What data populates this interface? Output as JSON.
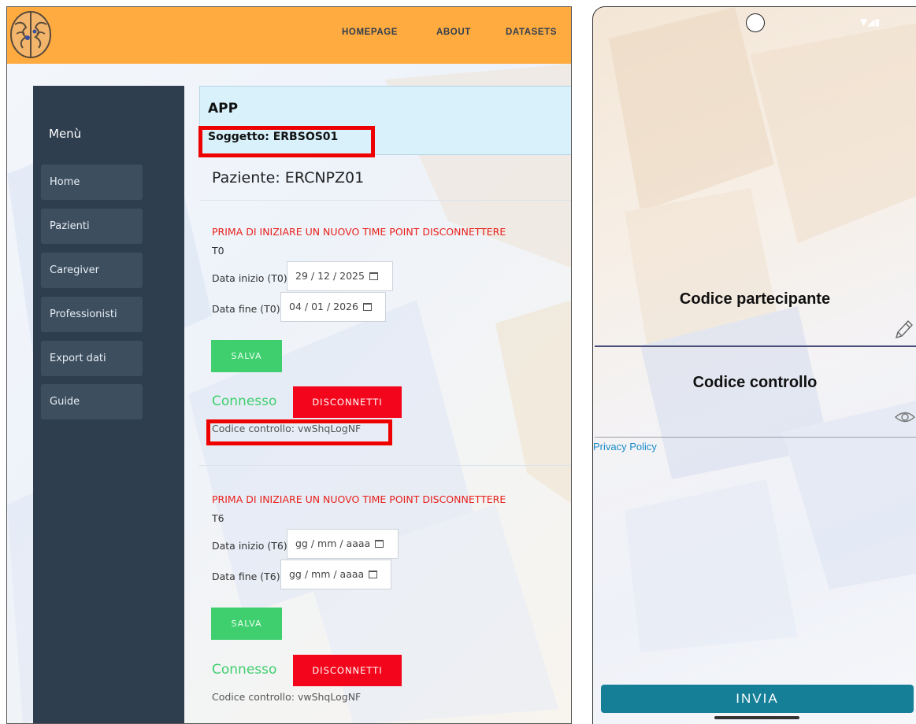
{
  "web": {
    "nav": {
      "homepage": "HOMEPAGE",
      "about": "ABOUT",
      "datasets": "DATASETS"
    },
    "sidebar": {
      "title": "Menù",
      "items": [
        {
          "label": "Home"
        },
        {
          "label": "Pazienti"
        },
        {
          "label": "Caregiver"
        },
        {
          "label": "Professionisti"
        },
        {
          "label": "Export dati"
        },
        {
          "label": "Guide"
        }
      ]
    },
    "app_card": {
      "title": "APP",
      "subject": "Soggetto: ERBSOS01"
    },
    "patient": "Paziente: ERCNPZ01",
    "timepoints": [
      {
        "warning": "PRIMA DI INIZIARE UN NUOVO TIME POINT DISCONNETTERE",
        "label": "T0",
        "start_label": "Data inizio (T0)",
        "start_value": "29 / 12 / 2025",
        "end_label": "Data fine (T0)",
        "end_value": "04 / 01 / 2026",
        "save_label": "SALVA",
        "status": "Connesso",
        "disconnect_label": "DISCONNETTI",
        "code": "Codice controllo: vwShqLogNF"
      },
      {
        "warning": "PRIMA DI INIZIARE UN NUOVO TIME POINT DISCONNETTERE",
        "label": "T6",
        "start_label": "Data inizio (T6)",
        "start_value": "gg / mm / aaaa",
        "end_label": "Data fine (T6)",
        "end_value": "gg / mm / aaaa",
        "save_label": "SALVA",
        "status": "Connesso",
        "disconnect_label": "DISCONNETTI",
        "code": "Codice controllo: vwShqLogNF"
      }
    ],
    "colors": {
      "header": "#ffab40",
      "sidebar": "#2f3e4e",
      "save": "#3fcf6e",
      "disconnect": "#f3061b",
      "highlight": "#ee0000"
    }
  },
  "phone": {
    "participant_code_label": "Codice partecipante",
    "control_code_label": "Codice controllo",
    "privacy_link": "Privacy Policy",
    "submit_label": "INVIA",
    "icons": {
      "edit": "pencil-icon",
      "visibility": "eye-icon"
    },
    "colors": {
      "submit": "#167f98",
      "link": "#1a8cc8",
      "participant_line": "#4a4f7a",
      "control_line": "#9aa0a8"
    }
  }
}
